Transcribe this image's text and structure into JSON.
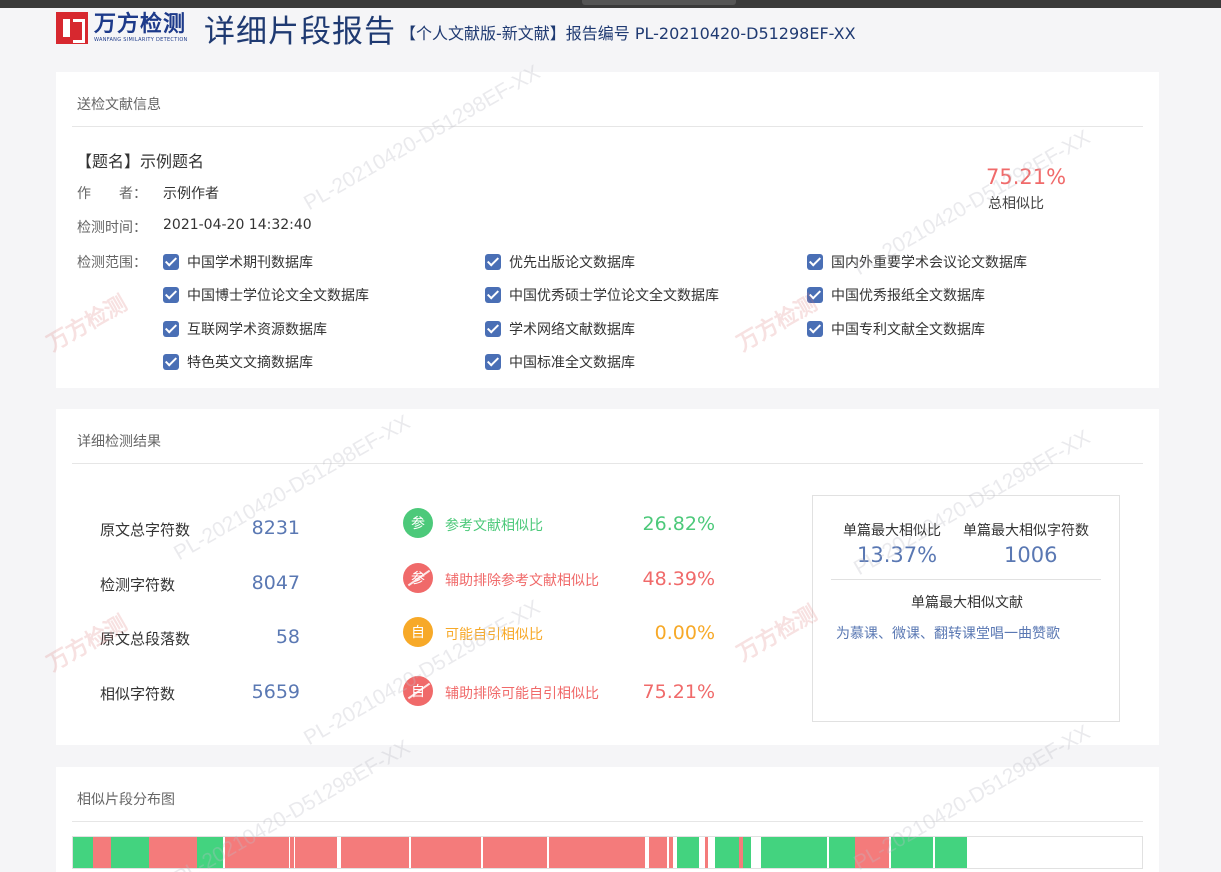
{
  "header": {
    "logo_text": "万方检测",
    "logo_subtext": "WANFANG SIMILARITY DETECTION",
    "title": "详细片段报告",
    "subtitle": "【个人文献版-新文献】报告编号 PL-20210420-D51298EF-XX"
  },
  "submission": {
    "section_title": "送检文献信息",
    "doc_title": "【题名】示例题名",
    "author_label": "作　　者：",
    "author": "示例作者",
    "time_label": "检测时间：",
    "time": "2021-04-20 14:32:40",
    "scope_label": "检测范围：",
    "total_similarity": "75.21%",
    "total_similarity_label": "总相似比",
    "databases": [
      "中国学术期刊数据库",
      "优先出版论文数据库",
      "国内外重要学术会议论文数据库",
      "中国博士学位论文全文数据库",
      "中国优秀硕士学位论文全文数据库",
      "中国优秀报纸全文数据库",
      "互联网学术资源数据库",
      "学术网络文献数据库",
      "中国专利文献全文数据库",
      "特色英文文摘数据库",
      "中国标准全文数据库"
    ]
  },
  "results": {
    "section_title": "详细检测结果",
    "stats": [
      {
        "label": "原文总字符数",
        "value": "8231"
      },
      {
        "label": "检测字符数",
        "value": "8047"
      },
      {
        "label": "原文总段落数",
        "value": "58"
      },
      {
        "label": "相似字符数",
        "value": "5659"
      }
    ],
    "rates": [
      {
        "icon": "参",
        "label": "参考文献相似比",
        "value": "26.82%",
        "color": "#4cc97a"
      },
      {
        "icon": "参",
        "label": "辅助排除参考文献相似比",
        "value": "48.39%",
        "color": "#f06a6a"
      },
      {
        "icon": "自",
        "label": "可能自引相似比",
        "value": "0.00%",
        "color": "#f7a928"
      },
      {
        "icon": "自",
        "label": "辅助排除可能自引相似比",
        "value": "75.21%",
        "color": "#f06a6a"
      }
    ],
    "summary": {
      "max_rate_label": "单篇最大相似比",
      "max_rate": "13.37%",
      "max_chars_label": "单篇最大相似字符数",
      "max_chars": "1006",
      "max_doc_label": "单篇最大相似文献",
      "max_doc": "为慕课、微课、翻转课堂唱一曲赞歌"
    }
  },
  "distribution": {
    "section_title": "相似片段分布图",
    "colors": {
      "similar": "#f47b7b",
      "reference": "#43d37f",
      "blank": "#ffffff"
    }
  },
  "watermark": {
    "text": "PL-20210420-D51298EF-XX",
    "logo": "万方检测"
  }
}
